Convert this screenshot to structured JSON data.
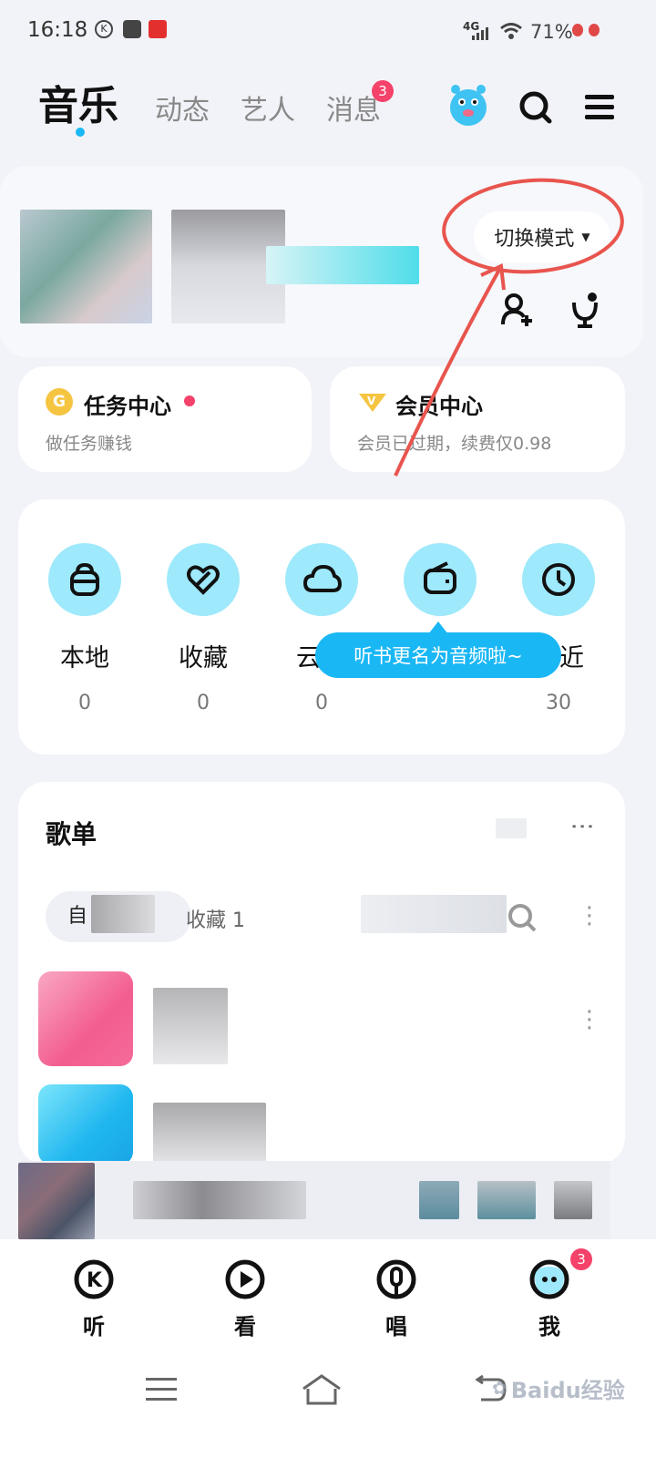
{
  "status_bar": {
    "time": "16:18",
    "battery": "71%",
    "network": "4G"
  },
  "top_tabs": [
    {
      "label": "音乐",
      "active": true
    },
    {
      "label": "动态",
      "active": false
    },
    {
      "label": "艺人",
      "active": false
    },
    {
      "label": "消息",
      "active": false,
      "badge": "3"
    }
  ],
  "profile": {
    "switch_mode_label": "切换模式"
  },
  "task_center": {
    "title": "任务中心",
    "subtitle": "做任务赚钱"
  },
  "vip_center": {
    "title": "会员中心",
    "subtitle": "会员已过期，续费仅0.98"
  },
  "library": [
    {
      "label": "本地",
      "count": "0",
      "icon": "bag-icon"
    },
    {
      "label": "收藏",
      "count": "0",
      "icon": "heart-icon"
    },
    {
      "label": "云",
      "count": "0",
      "icon": "cloud-icon"
    },
    {
      "label": "",
      "count": "0",
      "icon": "radio-icon"
    },
    {
      "label": "近",
      "count": "30",
      "icon": "clock-icon"
    }
  ],
  "tooltip": "听书更名为音频啦~",
  "playlist": {
    "title": "歌单",
    "filter_tabs": [
      "自",
      "收藏 1"
    ]
  },
  "bottom_nav": [
    {
      "label": "听",
      "icon": "listen-icon"
    },
    {
      "label": "看",
      "icon": "watch-icon"
    },
    {
      "label": "唱",
      "icon": "sing-icon"
    },
    {
      "label": "我",
      "icon": "me-icon",
      "badge": "3"
    }
  ],
  "watermark": "Baidu经验",
  "colors": {
    "accent": "#1ab7f5",
    "badge": "#f5426a",
    "annotation": "#e8554e",
    "circle_bg": "#9ee9fb"
  }
}
